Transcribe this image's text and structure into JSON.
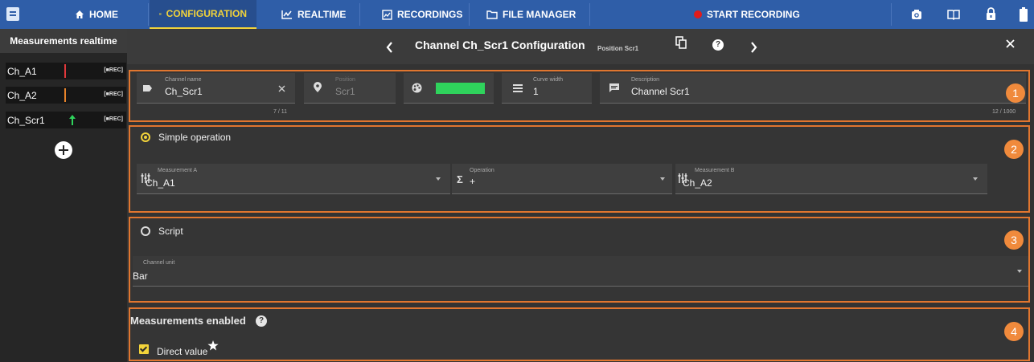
{
  "nav": {
    "home": "HOME",
    "configuration": "CONFIGURATION",
    "realtime": "REALTIME",
    "recordings": "RECORDINGS",
    "file_manager": "FILE MANAGER",
    "start_recording": "START RECORDING"
  },
  "sidebar": {
    "title": "Measurements realtime",
    "channels": [
      {
        "name": "Ch_A1",
        "rec": "[■REC]",
        "color": "#e0383b"
      },
      {
        "name": "Ch_A2",
        "rec": "[■REC]",
        "color": "#e7832a"
      },
      {
        "name": "Ch_Scr1",
        "rec": "[■REC]",
        "color": "#2fd35c"
      }
    ]
  },
  "header": {
    "title": "Channel Ch_Scr1 Configuration",
    "subtitle": "Position Scr1"
  },
  "section1": {
    "channel_name_label": "Channel name",
    "channel_name_value": "Ch_Scr1",
    "channel_name_counter": "7 / 11",
    "position_label": "Position",
    "position_value": "Scr1",
    "color": "#2fd35c",
    "curve_width_label": "Curve width",
    "curve_width_value": "1",
    "description_label": "Description",
    "description_value": "Channel Scr1",
    "description_counter": "12 / 1000",
    "badge": "1"
  },
  "section2": {
    "radio_label": "Simple operation",
    "measurement_a_label": "Measurement A",
    "measurement_a_value": "Ch_A1",
    "operation_label": "Operation",
    "operation_value": "+",
    "measurement_b_label": "Measurement B",
    "measurement_b_value": "Ch_A2",
    "badge": "2"
  },
  "section3": {
    "radio_label": "Script",
    "channel_unit_label": "Channel unit",
    "channel_unit_value": "Bar",
    "badge": "3"
  },
  "section4": {
    "title": "Measurements enabled",
    "checkbox_label": "Direct value",
    "badge": "4"
  },
  "colors": {
    "topbar": "#2f5ea8",
    "active_tab": "#f2d33a",
    "annotation": "#e1762f",
    "record": "#e11b1b"
  }
}
